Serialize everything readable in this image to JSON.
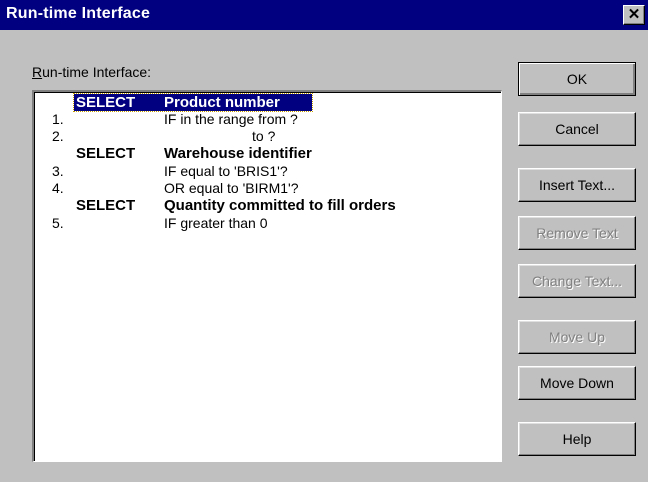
{
  "window": {
    "title": "Run-time Interface",
    "close_glyph": "✕"
  },
  "list": {
    "label_mnemonic": "R",
    "label_rest": "un-time Interface:",
    "rows": [
      {
        "type": "select",
        "keyword": "SELECT",
        "field": "Product number",
        "selected": true
      },
      {
        "type": "cond",
        "number": "1.",
        "text": "IF in the range from ?"
      },
      {
        "type": "cond",
        "number": "2.",
        "text": "to ?",
        "indent": true
      },
      {
        "type": "select",
        "keyword": "SELECT",
        "field": "Warehouse identifier"
      },
      {
        "type": "cond",
        "number": "3.",
        "text": "IF equal to 'BRIS1'?"
      },
      {
        "type": "cond",
        "number": "4.",
        "text": "OR equal to 'BIRM1'?"
      },
      {
        "type": "select",
        "keyword": "SELECT",
        "field": "Quantity committed to fill orders"
      },
      {
        "type": "cond",
        "number": "5.",
        "text": "IF greater than 0"
      }
    ]
  },
  "buttons": {
    "ok": "OK",
    "cancel": "Cancel",
    "insert_text": "Insert Text...",
    "remove_text": "Remove Text",
    "change_text": "Change Text...",
    "move_up": "Move Up",
    "move_down": "Move Down",
    "help": "Help"
  },
  "colors": {
    "title_bar": "#000080",
    "face": "#c0c0c0",
    "selection": "#000080"
  }
}
